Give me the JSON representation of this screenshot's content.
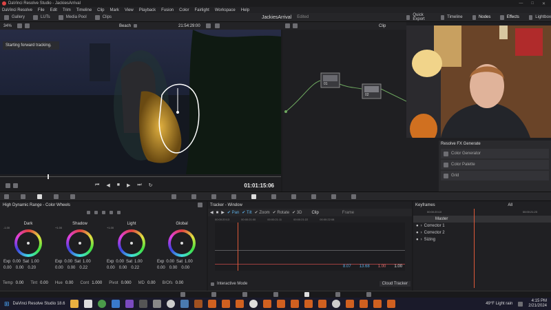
{
  "app": {
    "title": "DaVinci Resolve Studio - JackiesArrival"
  },
  "menu": [
    "DaVinci Resolve",
    "File",
    "Edit",
    "Trim",
    "Timeline",
    "Clip",
    "Mark",
    "View",
    "Playback",
    "Fusion",
    "Color",
    "Fairlight",
    "Workspace",
    "Help"
  ],
  "toolbar": {
    "left": [
      "Gallery",
      "LUTs",
      "Media Pool",
      "Clips"
    ],
    "project": "JackiesArrival",
    "project_status": "Edited",
    "right": [
      "Quick Export",
      "Timeline",
      "Nodes",
      "Effects",
      "Lightbox"
    ]
  },
  "viewer": {
    "zoom": "34%",
    "clip_name": "Beach",
    "timecode": "21:54:29:00",
    "status_msg": "Starting forward tracking.",
    "playhead_tc": "01:01:15:06"
  },
  "nodes": {
    "mode": "Clip",
    "node1": "01",
    "node2": "02"
  },
  "fx_generate": {
    "title": "Resolve FX Generate",
    "items": [
      "Color Generator",
      "Color Palette",
      "Grid"
    ]
  },
  "palette_icons": [
    "camera-raw-icon",
    "color-match-icon",
    "color-wheels-icon",
    "rgb-mixer-icon",
    "motion-effects-icon",
    "curves-icon",
    "color-warper-icon",
    "qualifier-icon",
    "window-icon",
    "tracker-icon",
    "magic-mask-icon",
    "blur-icon",
    "key-icon",
    "sizing-icon",
    "3d-icon"
  ],
  "wheels": {
    "title": "High Dynamic Range - Color Wheels",
    "zones": [
      {
        "name": "Dark",
        "range": "-1.00",
        "exp": "0.00",
        "sat": "1.00",
        "rgb": [
          "0.00",
          "0.00",
          "0.20"
        ]
      },
      {
        "name": "Shadow",
        "range": "+1.00",
        "exp": "0.00",
        "sat": "1.00",
        "rgb": [
          "0.00",
          "0.00",
          "0.22"
        ]
      },
      {
        "name": "Light",
        "range": "+1.00",
        "exp": "0.00",
        "sat": "1.00",
        "rgb": [
          "0.00",
          "0.00",
          "0.22"
        ]
      },
      {
        "name": "Global",
        "range": "",
        "exp": "0.00",
        "sat": "1.00",
        "rgb": [
          "0.00",
          "0.00",
          "0.00"
        ]
      }
    ],
    "exp_label": "Exp",
    "sat_label": "Sat",
    "bottom": [
      {
        "label": "Temp",
        "value": "0.00"
      },
      {
        "label": "Tint",
        "value": "0.00"
      },
      {
        "label": "Hue",
        "value": "0.00"
      },
      {
        "label": "Cont",
        "value": "1.000"
      },
      {
        "label": "Pivot",
        "value": "0.000"
      },
      {
        "label": "MD",
        "value": "0.00"
      },
      {
        "label": "B/Ofs",
        "value": "0.00"
      }
    ]
  },
  "tracker": {
    "title": "Tracker - Window",
    "checks": [
      "Pan",
      "Tilt",
      "Zoom",
      "Rotate",
      "3D"
    ],
    "modes": [
      "Clip",
      "Frame"
    ],
    "ruler": [
      "00:00:20:13",
      "00:00:21:00",
      "00:00:21:11",
      "00:00:21:22",
      "00:00:22:08"
    ],
    "values": [
      "8.07",
      "13.68",
      "1.00",
      "1.00"
    ],
    "interactive_mode": "Interactive Mode",
    "dropdown": "Cloud Tracker"
  },
  "keyframes": {
    "title": "Keyframes",
    "filter": "All",
    "tc_left": "00:00:20:10",
    "tc_right": "00:00:21:23",
    "items": [
      "Master",
      "Corrector 1",
      "Corrector 2",
      "Sizing"
    ]
  },
  "taskbar": {
    "start_label": "DaVinci Resolve Studio 18.6",
    "weather": "49°F  Light rain",
    "time": "4:15 PM",
    "date": "2/21/2024"
  },
  "colors": {
    "accent": "#e05a3a",
    "track_pan": "#5aaae0"
  }
}
